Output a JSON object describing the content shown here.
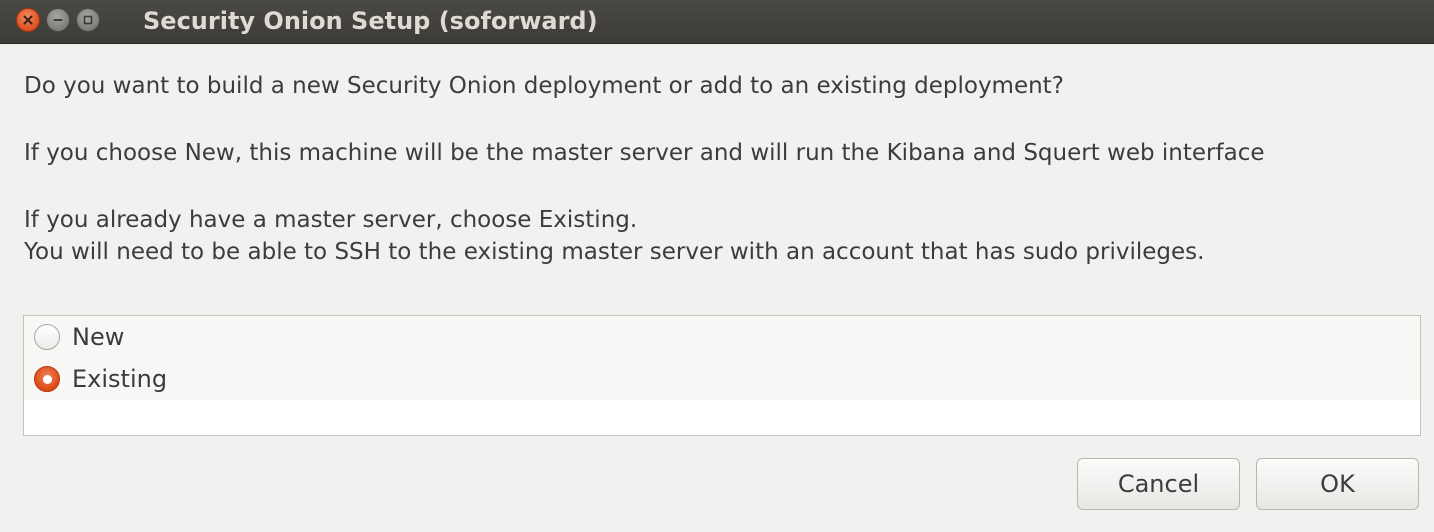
{
  "window": {
    "title": "Security Onion Setup (soforward)",
    "controls": {
      "close_icon": "close-icon",
      "minimize_icon": "minimize-icon",
      "maximize_icon": "maximize-icon"
    }
  },
  "message": {
    "line1": "Do you want to build a new Security Onion deployment or add to an existing deployment?",
    "line2": "If you choose New, this machine will be the master server and will run the Kibana and Squert web interface",
    "line3": "If you already have a master server, choose Existing.",
    "line4": "You will need to be able to SSH to the existing master server with an account that has sudo privileges."
  },
  "options": [
    {
      "label": "New",
      "selected": false
    },
    {
      "label": "Existing",
      "selected": true
    }
  ],
  "buttons": {
    "cancel": "Cancel",
    "ok": "OK"
  },
  "colors": {
    "accent": "#dd4814",
    "titlebar": "#3c3b37",
    "background": "#f2f1f0"
  }
}
